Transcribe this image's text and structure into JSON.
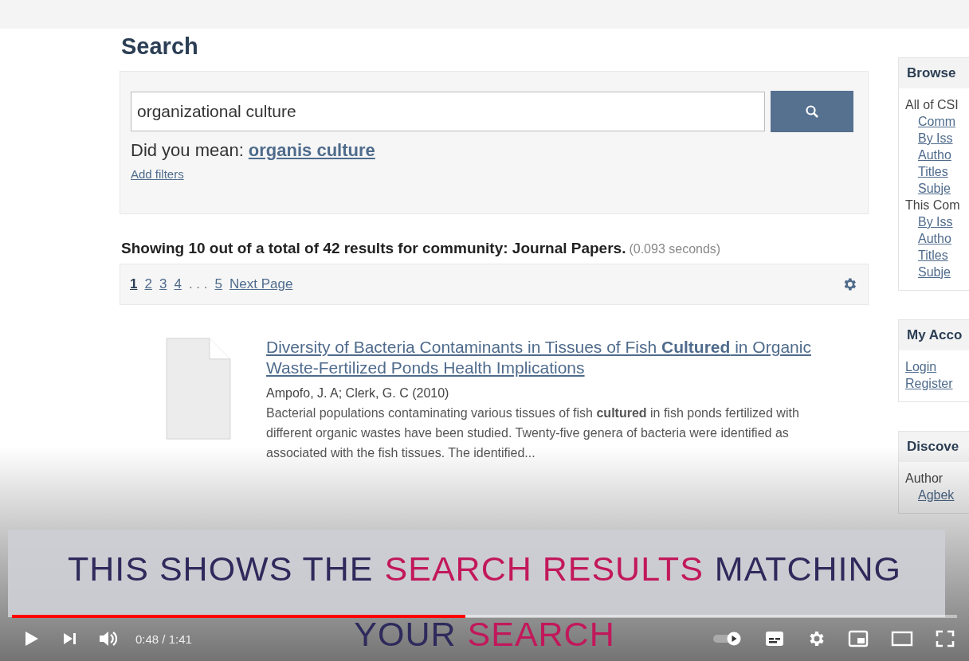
{
  "page": {
    "heading": "Search",
    "search": {
      "value": "organizational culture"
    },
    "did_you_mean": {
      "label": "Did you mean:",
      "suggestion": "organis culture"
    },
    "add_filters": "Add filters",
    "summary": {
      "text": "Showing 10 out of a total of 42 results for community: Journal Papers.",
      "timing": "(0.093 seconds)"
    },
    "pagination": [
      {
        "kind": "page",
        "label": "1",
        "selected": true
      },
      {
        "kind": "page",
        "label": "2",
        "selected": false
      },
      {
        "kind": "page",
        "label": "3",
        "selected": false
      },
      {
        "kind": "page",
        "label": "4",
        "selected": false
      },
      {
        "kind": "ellipsis",
        "label": ". . ."
      },
      {
        "kind": "page",
        "label": "5",
        "selected": false
      },
      {
        "kind": "next",
        "label": "Next Page"
      }
    ],
    "results": [
      {
        "title": "Diversity of Bacteria Contaminants in Tissues of Fish **Cultured** in Organic Waste-Fertilized Ponds Health Implications",
        "authors": "Ampofo, J. A; Clerk, G. C (2010)",
        "abstract": "Bacterial populations contaminating various tissues of fish **cultured** in fish ponds fertilized with different organic wastes have been studied. Twenty-five genera of bacteria were identified as associated with the fish tissues. The identified..."
      }
    ],
    "sidebar": [
      {
        "title": "Browse",
        "items": [
          {
            "kind": "heading",
            "label": "All of CSI"
          },
          {
            "kind": "link",
            "label": "Comm"
          },
          {
            "kind": "link",
            "label": "By Iss"
          },
          {
            "kind": "link",
            "label": "Autho"
          },
          {
            "kind": "link",
            "label": "Titles"
          },
          {
            "kind": "link",
            "label": "Subje"
          },
          {
            "kind": "heading",
            "label": "This Com"
          },
          {
            "kind": "link",
            "label": "By Iss"
          },
          {
            "kind": "link",
            "label": "Autho"
          },
          {
            "kind": "link",
            "label": "Titles"
          },
          {
            "kind": "link",
            "label": "Subje"
          }
        ]
      },
      {
        "title": "My Acco",
        "items": [
          {
            "kind": "plainlink",
            "label": "Login"
          },
          {
            "kind": "plainlink",
            "label": "Register"
          }
        ]
      },
      {
        "title": "Discove",
        "items": [
          {
            "kind": "heading",
            "label": "Author"
          },
          {
            "kind": "link",
            "label": "Agbek"
          }
        ]
      }
    ]
  },
  "caption": {
    "lines": [
      [
        {
          "text": "THIS SHOWS THE",
          "highlight": false
        },
        {
          "text": "SEARCH RESULTS",
          "highlight": true
        },
        {
          "text": "MATCHING",
          "highlight": false
        }
      ],
      [
        {
          "text": "YOUR",
          "highlight": false
        },
        {
          "text": "SEARCH",
          "highlight": true
        }
      ]
    ]
  },
  "player": {
    "progress": {
      "level": 0.48
    },
    "time": "0:48 / 1:41"
  }
}
